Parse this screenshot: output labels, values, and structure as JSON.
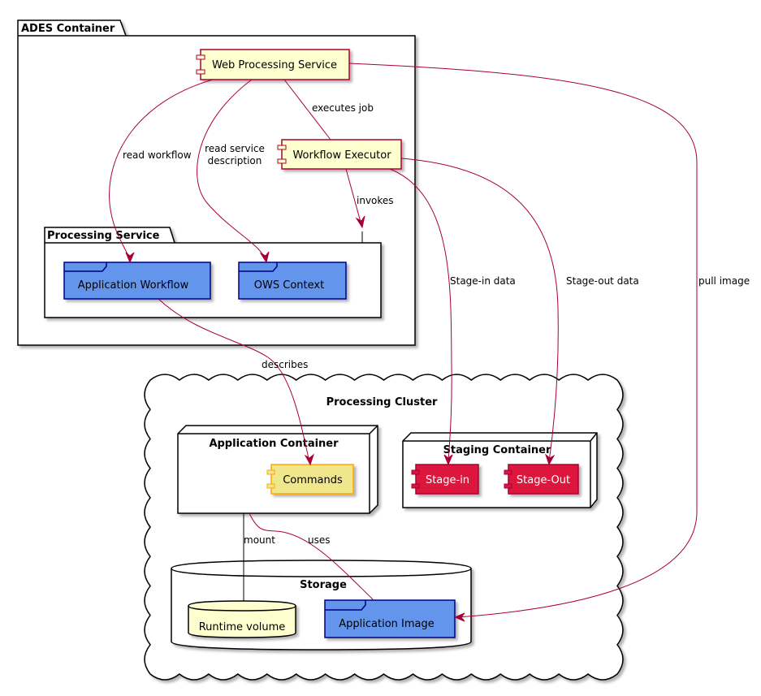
{
  "packages": {
    "ades": "ADES Container",
    "processing_service": "Processing Service"
  },
  "components": {
    "wps": "Web Processing Service",
    "workflow_executor": "Workflow Executor",
    "commands": "Commands",
    "stage_in": "Stage-in",
    "stage_out": "Stage-Out"
  },
  "frames": {
    "application_workflow": "Application Workflow",
    "ows_context": "OWS Context",
    "application_image": "Application Image"
  },
  "cloud": {
    "title": "Processing Cluster"
  },
  "nodes": {
    "application_container": "Application Container",
    "staging_container": "Staging Container"
  },
  "databases": {
    "storage": "Storage",
    "runtime_volume": "Runtime volume"
  },
  "edges": {
    "executes_job": "executes job",
    "read_workflow": "read workflow",
    "read_service_1": "read service",
    "read_service_2": "description",
    "invokes": "invokes",
    "stage_in_data": "Stage-in data",
    "stage_out_data": "Stage-out data",
    "pull_image": "pull image",
    "describes": "describes",
    "mount": "mount",
    "uses": "uses"
  },
  "colors": {
    "edge": "#A80036",
    "component_fill": "#FEFECE",
    "frame_fill": "#6495ED",
    "commands_fill": "#F0E68C",
    "staging_fill": "#DC143C"
  }
}
